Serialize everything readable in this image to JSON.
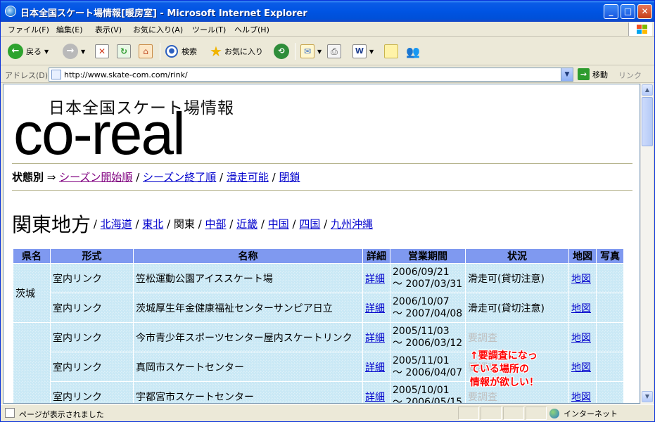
{
  "window": {
    "title": "日本全国スケート場情報[暖房室] - Microsoft Internet Explorer"
  },
  "menu": [
    "ファイル(F)",
    "編集(E)",
    "表示(V)",
    "お気に入り(A)",
    "ツール(T)",
    "ヘルプ(H)"
  ],
  "toolbar": {
    "back": "戻る",
    "search": "検索",
    "favorites": "お気に入り"
  },
  "address": {
    "label": "アドレス(D)",
    "url": "http://www.skate-com.com/rink/",
    "go": "移動",
    "links": "リンク"
  },
  "page": {
    "logo_sub": "日本全国スケート場情報",
    "logo_main": "co-real",
    "sort": {
      "label": "状態別",
      "arrow": "⇒",
      "links": [
        "シーズン開始順",
        "シーズン終了順",
        "滑走可能",
        "閉鎖"
      ]
    },
    "region": {
      "title": "関東地方",
      "links": [
        "北海道",
        "東北",
        "関東",
        "中部",
        "近畿",
        "中国",
        "四国",
        "九州沖縄"
      ]
    },
    "table": {
      "headers": [
        "県名",
        "形式",
        "名称",
        "詳細",
        "営業期間",
        "状況",
        "地図",
        "写真"
      ],
      "pref_1": "茨城",
      "rows": [
        {
          "type": "室内リンク",
          "name": "笠松運動公園アイススケート場",
          "detail": "詳細",
          "start": "2006/09/21",
          "end": "～ 2007/03/31",
          "status": "滑走可(貸切注意)",
          "map": "地図"
        },
        {
          "type": "室内リンク",
          "name": "茨城厚生年金健康福祉センターサンピア日立",
          "detail": "詳細",
          "start": "2006/10/07",
          "end": "～ 2007/04/08",
          "status": "滑走可(貸切注意)",
          "map": "地図"
        },
        {
          "type": "室内リンク",
          "name": "今市青少年スポーツセンター屋内スケートリンク",
          "detail": "詳細",
          "start": "2005/11/03",
          "end": "～ 2006/03/12",
          "status": "要調査",
          "map": "地図"
        },
        {
          "type": "室内リンク",
          "name": "真岡市スケートセンター",
          "detail": "詳細",
          "start": "2005/11/01",
          "end": "～ 2006/04/07",
          "status": "要調査",
          "map": "地図"
        },
        {
          "type": "室内リンク",
          "name": "宇都宮市スケートセンター",
          "detail": "詳細",
          "start": "2005/10/01",
          "end": "～ 2006/05/15",
          "status": "要調査",
          "map": "地図"
        }
      ]
    },
    "annotation": [
      "↑要調査になっ",
      "ている場所の",
      "情報が欲しい！"
    ]
  },
  "status": {
    "text": "ページが表示されました",
    "zone": "インターネット"
  }
}
